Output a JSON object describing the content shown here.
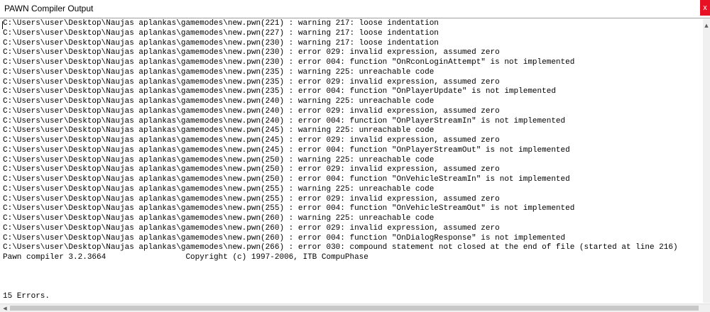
{
  "window": {
    "title": "PAWN Compiler Output",
    "close_label": "x"
  },
  "output": {
    "lines": [
      "C:\\Users\\user\\Desktop\\Naujas aplankas\\gamemodes\\new.pwn(221) : warning 217: loose indentation",
      "C:\\Users\\user\\Desktop\\Naujas aplankas\\gamemodes\\new.pwn(227) : warning 217: loose indentation",
      "C:\\Users\\user\\Desktop\\Naujas aplankas\\gamemodes\\new.pwn(230) : warning 217: loose indentation",
      "C:\\Users\\user\\Desktop\\Naujas aplankas\\gamemodes\\new.pwn(230) : error 029: invalid expression, assumed zero",
      "C:\\Users\\user\\Desktop\\Naujas aplankas\\gamemodes\\new.pwn(230) : error 004: function \"OnRconLoginAttempt\" is not implemented",
      "C:\\Users\\user\\Desktop\\Naujas aplankas\\gamemodes\\new.pwn(235) : warning 225: unreachable code",
      "C:\\Users\\user\\Desktop\\Naujas aplankas\\gamemodes\\new.pwn(235) : error 029: invalid expression, assumed zero",
      "C:\\Users\\user\\Desktop\\Naujas aplankas\\gamemodes\\new.pwn(235) : error 004: function \"OnPlayerUpdate\" is not implemented",
      "C:\\Users\\user\\Desktop\\Naujas aplankas\\gamemodes\\new.pwn(240) : warning 225: unreachable code",
      "C:\\Users\\user\\Desktop\\Naujas aplankas\\gamemodes\\new.pwn(240) : error 029: invalid expression, assumed zero",
      "C:\\Users\\user\\Desktop\\Naujas aplankas\\gamemodes\\new.pwn(240) : error 004: function \"OnPlayerStreamIn\" is not implemented",
      "C:\\Users\\user\\Desktop\\Naujas aplankas\\gamemodes\\new.pwn(245) : warning 225: unreachable code",
      "C:\\Users\\user\\Desktop\\Naujas aplankas\\gamemodes\\new.pwn(245) : error 029: invalid expression, assumed zero",
      "C:\\Users\\user\\Desktop\\Naujas aplankas\\gamemodes\\new.pwn(245) : error 004: function \"OnPlayerStreamOut\" is not implemented",
      "C:\\Users\\user\\Desktop\\Naujas aplankas\\gamemodes\\new.pwn(250) : warning 225: unreachable code",
      "C:\\Users\\user\\Desktop\\Naujas aplankas\\gamemodes\\new.pwn(250) : error 029: invalid expression, assumed zero",
      "C:\\Users\\user\\Desktop\\Naujas aplankas\\gamemodes\\new.pwn(250) : error 004: function \"OnVehicleStreamIn\" is not implemented",
      "C:\\Users\\user\\Desktop\\Naujas aplankas\\gamemodes\\new.pwn(255) : warning 225: unreachable code",
      "C:\\Users\\user\\Desktop\\Naujas aplankas\\gamemodes\\new.pwn(255) : error 029: invalid expression, assumed zero",
      "C:\\Users\\user\\Desktop\\Naujas aplankas\\gamemodes\\new.pwn(255) : error 004: function \"OnVehicleStreamOut\" is not implemented",
      "C:\\Users\\user\\Desktop\\Naujas aplankas\\gamemodes\\new.pwn(260) : warning 225: unreachable code",
      "C:\\Users\\user\\Desktop\\Naujas aplankas\\gamemodes\\new.pwn(260) : error 029: invalid expression, assumed zero",
      "C:\\Users\\user\\Desktop\\Naujas aplankas\\gamemodes\\new.pwn(260) : error 004: function \"OnDialogResponse\" is not implemented",
      "C:\\Users\\user\\Desktop\\Naujas aplankas\\gamemodes\\new.pwn(266) : error 030: compound statement not closed at the end of file (started at line 216)",
      "Pawn compiler 3.2.3664                 Copyright (c) 1997-2006, ITB CompuPhase",
      "",
      "",
      "",
      "15 Errors."
    ]
  }
}
